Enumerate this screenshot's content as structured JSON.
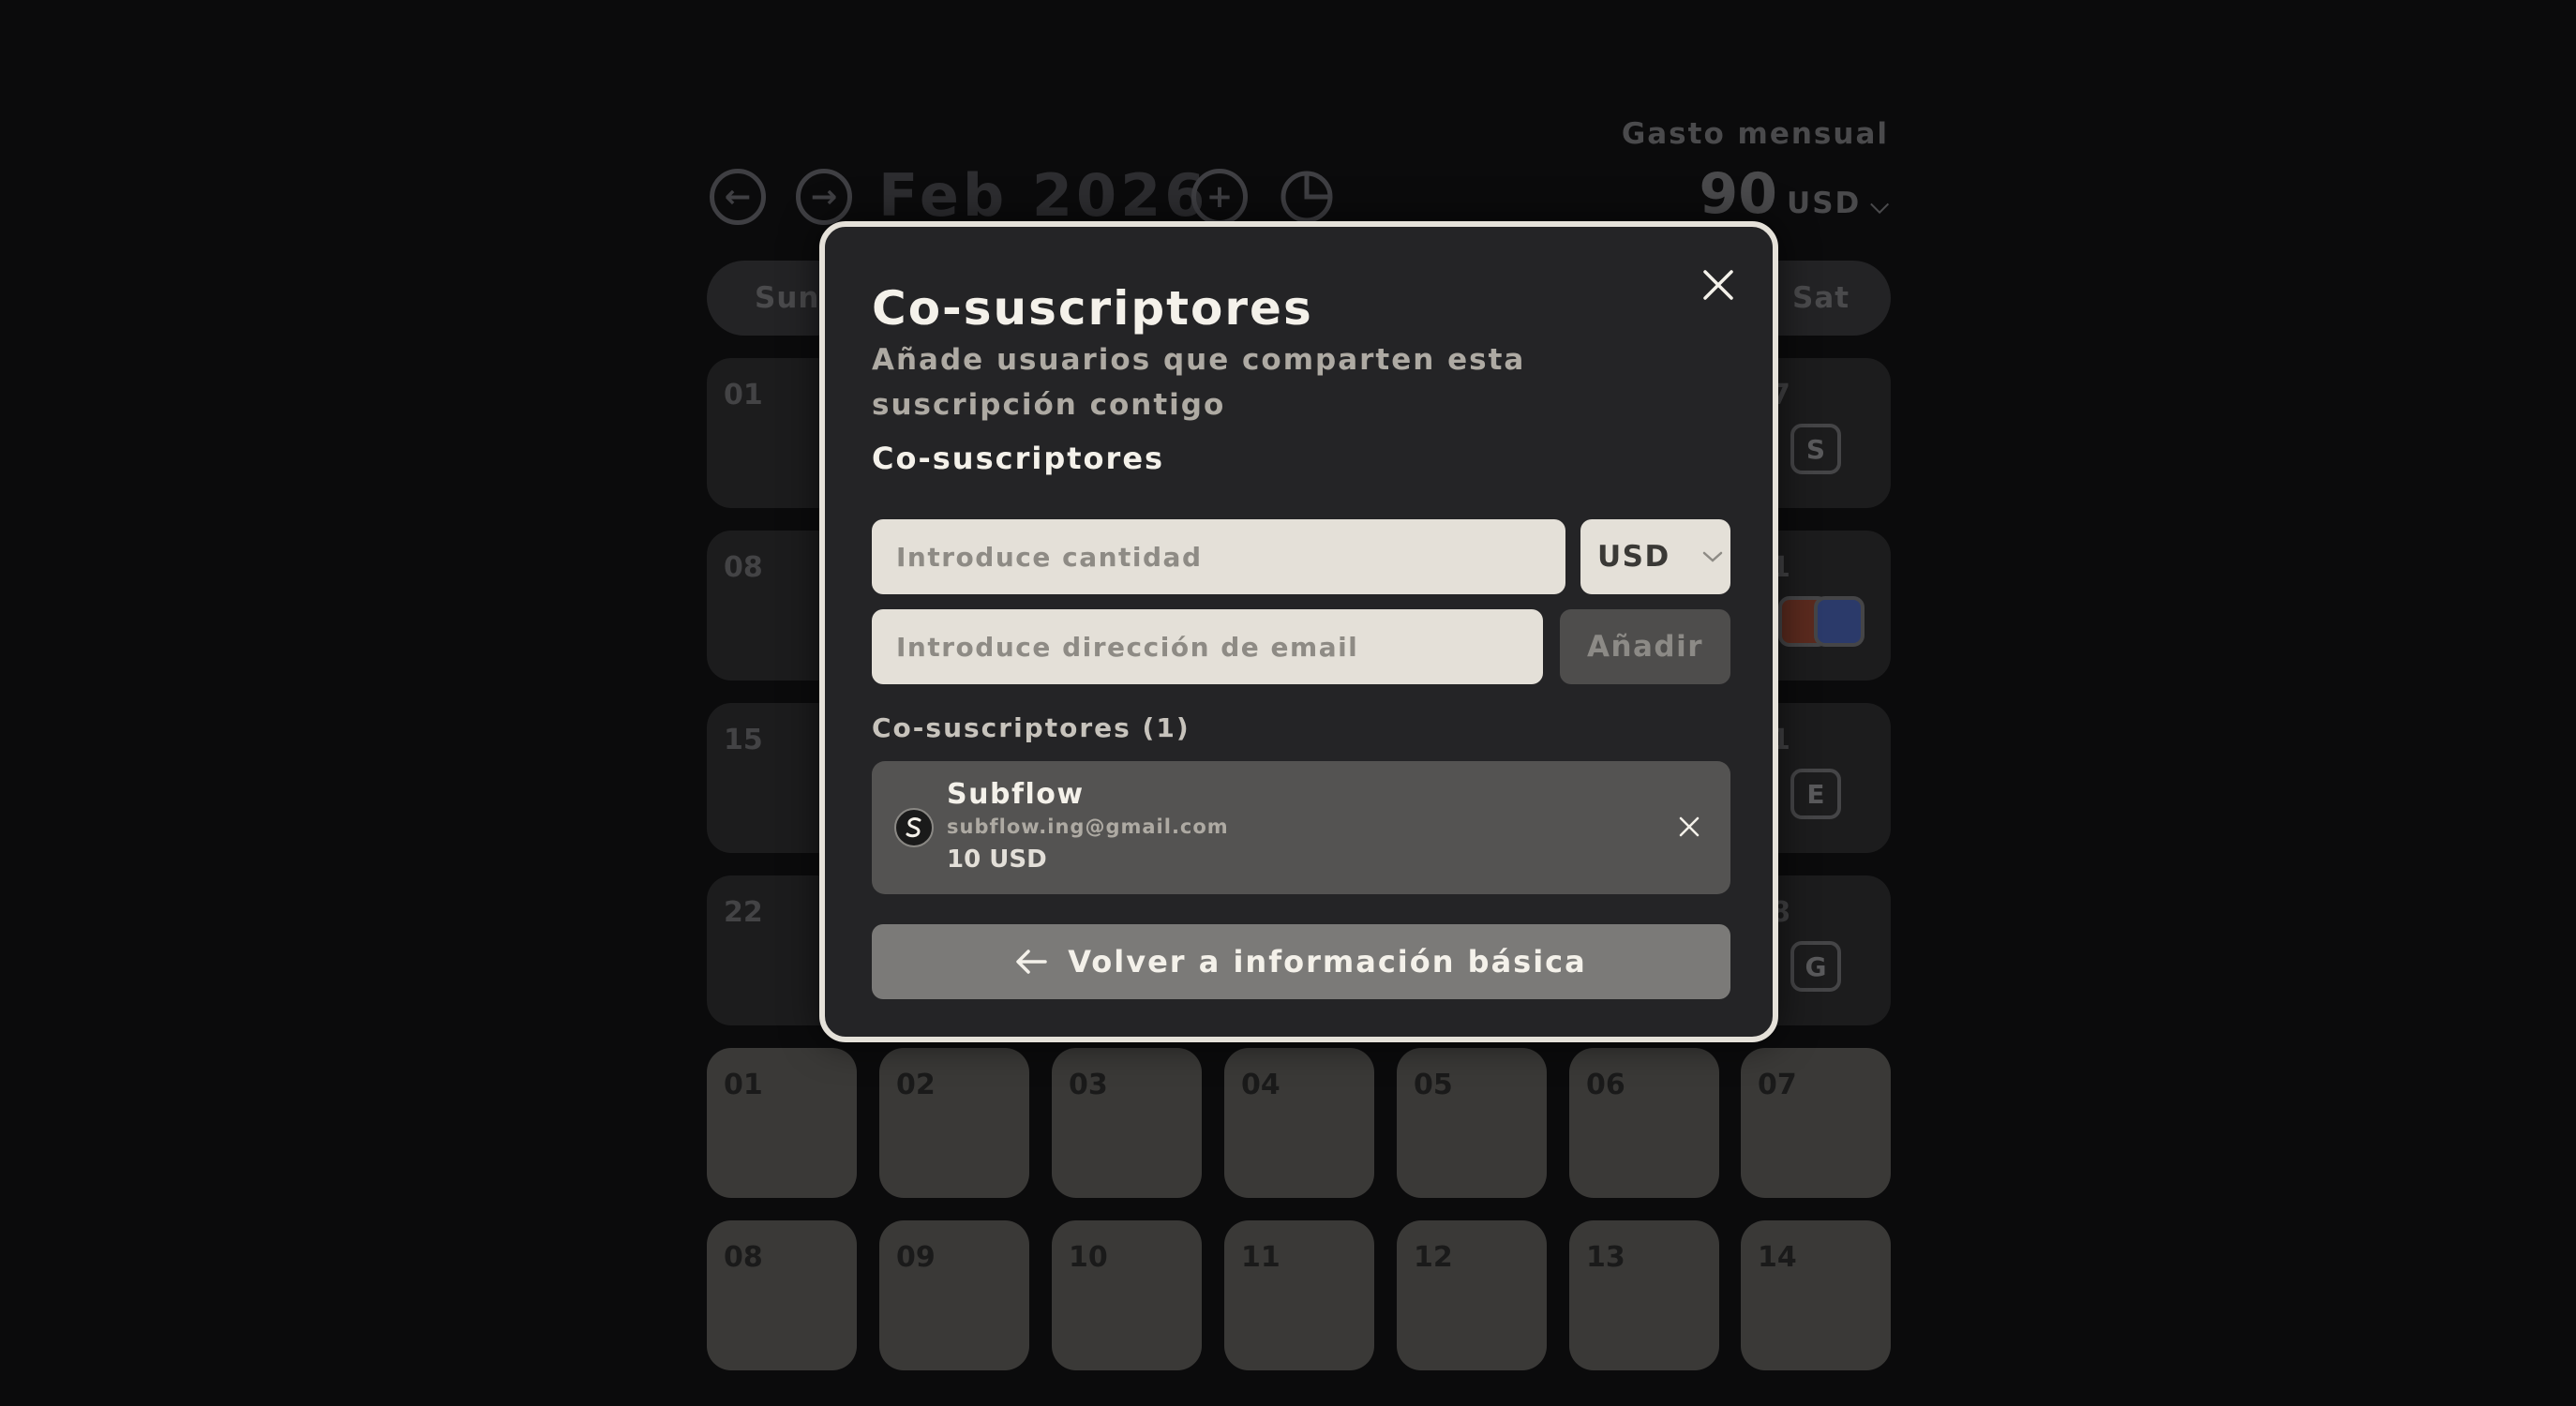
{
  "header": {
    "month_title": "Feb 2026",
    "prev_icon": "arrow-left-circle-icon",
    "next_icon": "arrow-right-circle-icon",
    "add_icon": "plus-circle-icon",
    "stats_icon": "pie-chart-icon",
    "spend_label": "Gasto mensual",
    "spend_value": "90",
    "spend_currency": "USD"
  },
  "calendar": {
    "weekdays": {
      "first": "Sun",
      "last": "Sat"
    },
    "dim_days": [
      "01",
      "08",
      "15",
      "22"
    ],
    "dim_partial": [
      "7",
      "1",
      "1",
      "8"
    ],
    "badges": [
      "S",
      "E",
      "G"
    ],
    "next_rows": [
      [
        "01",
        "02",
        "03",
        "04",
        "05",
        "06",
        "07"
      ],
      [
        "08",
        "09",
        "10",
        "11",
        "12",
        "13",
        "14"
      ]
    ]
  },
  "modal": {
    "title": "Co-suscriptores",
    "subtitle": "Añade usuarios que comparten esta suscripción contigo",
    "section_label": "Co-suscriptores",
    "amount_placeholder": "Introduce cantidad",
    "currency": "USD",
    "email_placeholder": "Introduce dirección de email",
    "add_label": "Añadir",
    "list_label": "Co-suscriptores (1)",
    "cosubscribers": [
      {
        "name": "Subflow",
        "email": "subflow.ing@gmail.com",
        "amount": "10 USD"
      }
    ],
    "back_label": "Volver a información básica"
  },
  "colors": {
    "modal_border": "#e5e1d9",
    "modal_bg": "#242426",
    "input_bg": "#e4e0d8",
    "back_button": "#7b7a78"
  }
}
